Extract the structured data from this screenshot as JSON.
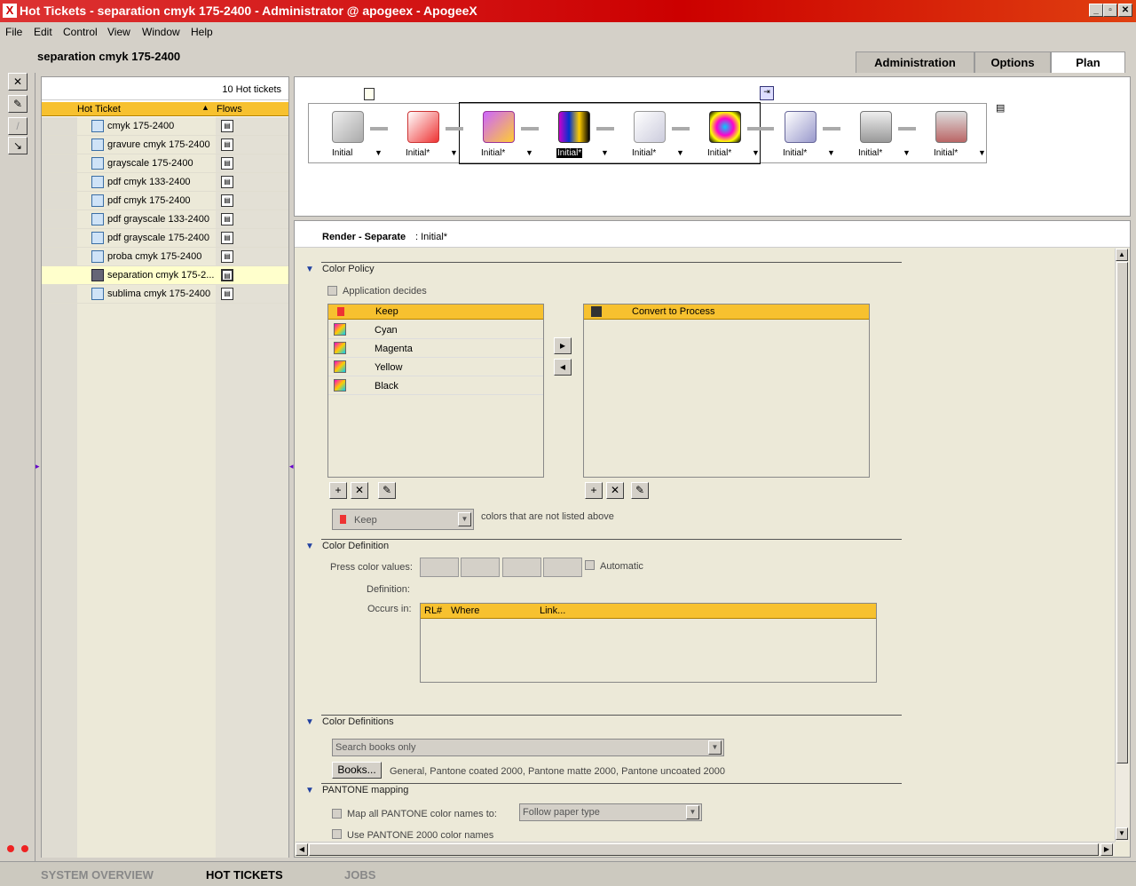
{
  "window": {
    "title": "Hot Tickets - separation cmyk 175-2400 - Administrator @ apogeex - ApogeeX",
    "app_icon": "X"
  },
  "menu": [
    "File",
    "Edit",
    "Control",
    "View",
    "Window",
    "Help"
  ],
  "document_title": "separation cmyk 175-2400",
  "tabs": [
    {
      "label": "Administration"
    },
    {
      "label": "Options"
    },
    {
      "label": "Plan"
    }
  ],
  "hot_tickets": {
    "count_label": "10 Hot tickets",
    "col_ticket": "Hot Ticket",
    "col_flows": "Flows",
    "items": [
      "cmyk 175-2400",
      "gravure cmyk 175-2400",
      "grayscale 175-2400",
      "pdf cmyk 133-2400",
      "pdf cmyk 175-2400",
      "pdf grayscale 133-2400",
      "pdf grayscale 175-2400",
      "proba cmyk 175-2400",
      "separation cmyk 175-2...",
      "sublima cmyk 175-2400"
    ]
  },
  "flow_nodes": [
    "Initial",
    "Initial*",
    "Initial*",
    "Initial*",
    "Initial*",
    "Initial*",
    "Initial*",
    "Initial*",
    "Initial*"
  ],
  "detail": {
    "title": "Render - Separate",
    "subtitle": ": Initial*",
    "color_policy": {
      "section": "Color Policy",
      "app_decides": "Application decides",
      "keep_header": "Keep",
      "convert_header": "Convert to Process",
      "keep_items": [
        "Cyan",
        "Magenta",
        "Yellow",
        "Black"
      ],
      "not_listed_value": "Keep",
      "not_listed_label": "colors that are not listed above"
    },
    "color_definition": {
      "section": "Color Definition",
      "press_values": "Press color values:",
      "automatic": "Automatic",
      "definition": "Definition:",
      "occurs_in": "Occurs in:",
      "cols": [
        "RL#",
        "Where",
        "Link..."
      ]
    },
    "color_definitions": {
      "section": "Color Definitions",
      "search_value": "Search books only",
      "books_button": "Books...",
      "books_list": "General, Pantone coated 2000, Pantone matte 2000, Pantone uncoated 2000"
    },
    "pantone": {
      "section": "PANTONE mapping",
      "map_all": "Map all PANTONE color names to:",
      "map_value": "Follow paper type",
      "use_2000": "Use PANTONE 2000 color names"
    }
  },
  "bottom_tabs": [
    "SYSTEM OVERVIEW",
    "HOT TICKETS",
    "JOBS"
  ]
}
